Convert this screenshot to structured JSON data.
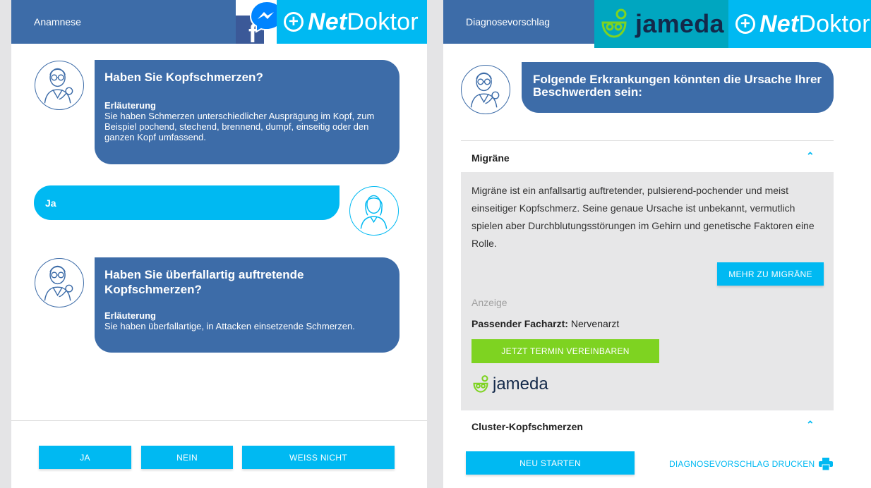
{
  "left": {
    "title": "Anamnese",
    "brand": {
      "net": "Net",
      "doktor": "Doktor"
    },
    "messages": [
      {
        "question": "Haben Sie Kopfschmerzen?",
        "label": "Erläuterung",
        "explanation": "Sie haben Schmerzen unterschiedlicher Ausprägung im Kopf, zum Beispiel pochend, stechend, brennend, dumpf, einseitig oder den ganzen Kopf umfassend."
      },
      {
        "question": "Haben Sie überfallartig auftretende Kopfschmerzen?",
        "label": "Erläuterung",
        "explanation": "Sie haben überfallartige, in Attacken einsetzende Schmerzen."
      }
    ],
    "answer": "Ja",
    "buttons": {
      "yes": "JA",
      "no": "NEIN",
      "unknown": "WEISS NICHT"
    }
  },
  "right": {
    "title": "Diagnosevorschlag",
    "brand": {
      "jameda": "jameda",
      "net": "Net",
      "doktor": "Doktor"
    },
    "intro": "Folgende Erkrankungen könnten die Ursache Ihrer Beschwerden sein:",
    "diagnoses": [
      {
        "name": "Migräne",
        "description": "Migräne ist ein anfallsartig auftretender, pulsierend-pochender und meist einseitiger Kopfschmerz. Seine genaue Ursache ist unbekannt, vermutlich spielen aber Durchblutungsstörungen im Gehirn und genetische Faktoren eine Rolle.",
        "more_button": "MEHR ZU MIGRÄNE",
        "ad_label": "Anzeige",
        "specialist_label": "Passender Facharzt:",
        "specialist": "Nervenarzt",
        "appointment_button": "JETZT TERMIN VEREINBAREN",
        "partner": "jameda"
      },
      {
        "name": "Cluster-Kopfschmerzen"
      }
    ],
    "restart_button": "NEU STARTEN",
    "print_link": "DIAGNOSEVORSCHLAG DRUCKEN"
  },
  "colors": {
    "primary": "#3d6ca8",
    "accent": "#00b9f2",
    "green": "#7ed321",
    "jameda_bg": "#00a6c0",
    "panel_bg": "#e7e7e8"
  },
  "icons": {
    "brand_cross": "plus-circle-icon",
    "messenger": "facebook-messenger-icon",
    "doctor": "doctor-avatar-icon",
    "patient": "patient-avatar-icon",
    "chevron": "chevron-up-icon",
    "print": "printer-icon",
    "jameda": "jameda-logo-icon"
  }
}
